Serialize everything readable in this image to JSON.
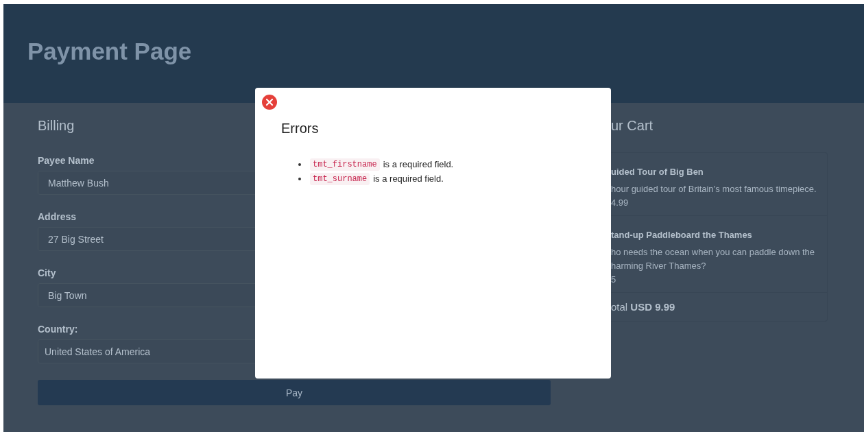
{
  "header": {
    "title": "Payment Page"
  },
  "billing": {
    "title": "Billing",
    "fields": [
      {
        "label": "Payee Name",
        "value": "Matthew Bush",
        "kind": "text"
      },
      {
        "label": "Address",
        "value": "27 Big Street",
        "kind": "text"
      },
      {
        "label": "City",
        "value": "Big Town",
        "kind": "text"
      },
      {
        "label": "Country:",
        "value": "United States of America",
        "kind": "select"
      }
    ],
    "pay_button": "Pay"
  },
  "cart": {
    "title": "ur Cart",
    "items": [
      {
        "name": "uided Tour of Big Ben",
        "description": "hour guided tour of Britain’s most famous timepiece.",
        "price": "4.99"
      },
      {
        "name": "tand-up Paddleboard the Thames",
        "description": "ho needs the ocean when you can paddle down the harming River Thames?",
        "price": "5"
      }
    ],
    "total": "otal **USD 9.99**"
  },
  "modal": {
    "title": "Errors",
    "errors": [
      {
        "field": "tmt_firstname",
        "message": "is a required field."
      },
      {
        "field": "tmt_surname",
        "message": "is a required field."
      }
    ]
  }
}
